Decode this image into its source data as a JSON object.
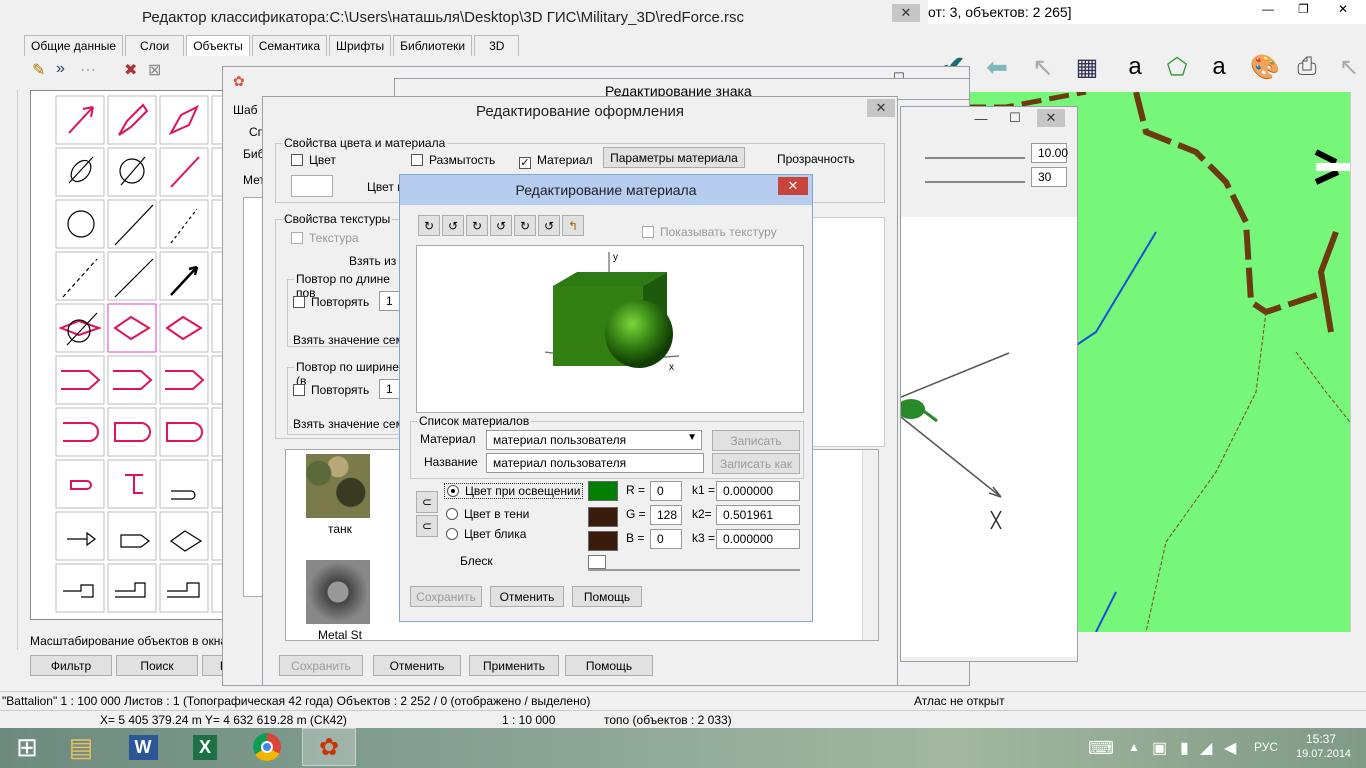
{
  "main_title": "Редактор классификатора:C:\\Users\\наташьля\\Desktop\\3D ГИС\\Military_3D\\redForce.rsc",
  "top_right_status": "от: 3, объектов: 2 265]",
  "tabs": [
    "Общие данные",
    "Слои",
    "Объекты",
    "Семантика",
    "Шрифты",
    "Библиотеки",
    "3D"
  ],
  "active_tab": "Объекты",
  "left_bottom_text": "Масштабирование объектов в окнах - пример",
  "left_buttons": {
    "filter": "Фильтр",
    "search": "Поиск",
    "help": "Помощь"
  },
  "design_dialog": {
    "title": "Редактирование оформления",
    "color_group": "Свойства цвета и материала",
    "chk_color": "Цвет",
    "chk_blur": "Размытость",
    "chk_material": "Материал",
    "material_params": "Параметры материала",
    "transparency": "Прозрачность",
    "color_label": "Цвет п",
    "texture_group": "Свойства текстуры",
    "texture": "Текстура",
    "take_from": "Взять из",
    "repeat_length": "Повтор по длине пов",
    "repeat": "Повторять",
    "one": "1",
    "take_sem": "Взять значение сема",
    "repeat_width": "Повтор по ширине (в",
    "tex_tank": "танк",
    "tex_metal": "Metal St",
    "save": "Сохранить",
    "cancel": "Отменить",
    "apply": "Применить",
    "help": "Помощь",
    "scale_a": "10.00",
    "scale_b": "30"
  },
  "behind_titles": {
    "sign": "Редактирование знака",
    "shab": "Шаб",
    "sp": "Сп",
    "bib": "Биб",
    "met": "Мет"
  },
  "material_dialog": {
    "title": "Редактирование материала",
    "show_texture": "Показывать текстуру",
    "list_group": "Список материалов",
    "material_label": "Материал",
    "material_value": "материал пользователя",
    "name_label": "Название",
    "name_value": "материал пользователя",
    "write": "Записать",
    "write_as": "Записать как",
    "light": "Цвет при освещении",
    "shade": "Цвет в тени",
    "glare": "Цвет блика",
    "shine": "Блеск",
    "r_label": "R =",
    "g_label": "G =",
    "b_label": "B =",
    "r": "0",
    "g": "128",
    "b": "0",
    "k1_label": "k1 =",
    "k2_label": "k2=",
    "k3_label": "k3 =",
    "k1": "0.000000",
    "k2": "0.501961",
    "k3": "0.000000",
    "save": "Сохранить",
    "cancel": "Отменить",
    "help": "Помощь",
    "axis_y": "y",
    "axis_x": "x"
  },
  "status1": {
    "left": "\"Battalion\"  1 : 100 000   Листов : 1   (Топографическая 42 года)  Объектов : 2 252 / 0 (отображено / выделено)",
    "right": "Атлас не открыт"
  },
  "status2": {
    "coords": "X= 5 405 379.24 m     Y= 4 632 619.28 m  (СК42)",
    "scale": "1 : 10 000",
    "topo": "топо   (объектов : 2 033)"
  },
  "taskbar": {
    "lang": "РУС",
    "time": "15:37",
    "date": "19.07.2014"
  },
  "colors": {
    "map": "#77f77a",
    "road": "#6b3a0f",
    "magenta": "#e0115f",
    "light": "#007f00",
    "shade": "#3a1c0c",
    "glare": "#3a1c0c"
  }
}
